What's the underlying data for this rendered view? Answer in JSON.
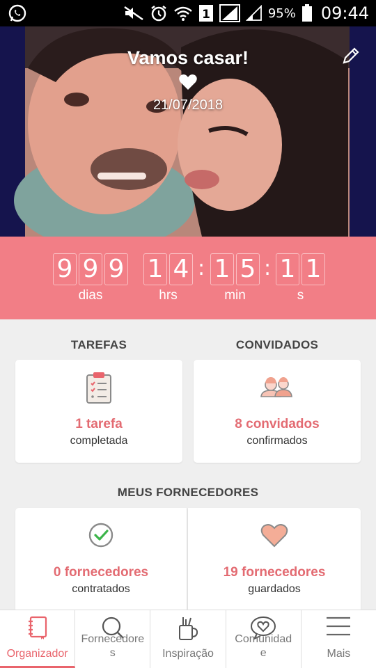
{
  "statusbar": {
    "battery_percent": "95%",
    "time": "09:44",
    "sim_slot": "1"
  },
  "hero": {
    "title": "Vamos casar!",
    "date": "21/07/2018"
  },
  "countdown": {
    "days_digits": [
      "9",
      "9",
      "9"
    ],
    "hours_digits": [
      "1",
      "4"
    ],
    "minutes_digits": [
      "1",
      "5"
    ],
    "seconds_digits": [
      "1",
      "1"
    ],
    "units": {
      "days": "dias",
      "hours": "hrs",
      "minutes": "min",
      "seconds": "s"
    }
  },
  "tasks": {
    "heading": "TAREFAS",
    "count": "1 tarefa",
    "sub": "completada"
  },
  "guests": {
    "heading": "CONVIDADOS",
    "count": "8 convidados",
    "sub": "confirmados"
  },
  "suppliers": {
    "heading": "MEUS FORNECEDORES",
    "hired_count": "0 fornecedores",
    "hired_sub": "contratados",
    "saved_count": "19 fornecedores",
    "saved_sub": "guardados"
  },
  "nav": {
    "items": [
      {
        "label": "Organizador",
        "icon": "notebook-icon",
        "active": true
      },
      {
        "label": "Fornecedore\ns",
        "icon": "search-icon",
        "active": false
      },
      {
        "label": "Inspiração",
        "icon": "craft-tools-icon",
        "active": false
      },
      {
        "label": "Comunidad\ne",
        "icon": "heart-chat-icon",
        "active": false
      },
      {
        "label": "Mais",
        "icon": "menu-icon",
        "active": false
      }
    ]
  },
  "colors": {
    "accent": "#f27e86",
    "accent_text": "#e36b72",
    "background": "#efefef"
  }
}
